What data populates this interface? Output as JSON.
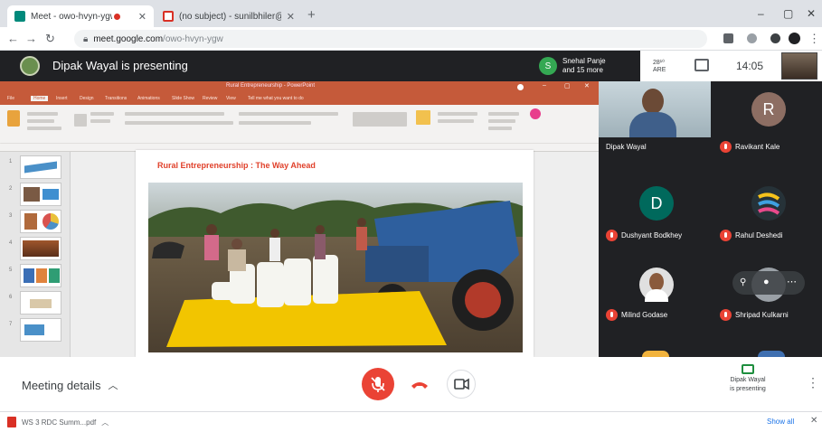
{
  "browser": {
    "tabs": [
      {
        "label": "Meet - owo-hvyn-ygw",
        "active": true
      },
      {
        "label": "(no subject) - sunilbhiler@smtp...",
        "active": false
      }
    ],
    "url_host": "meet.google.com",
    "url_path": "/owo-hvyn-ygw"
  },
  "meet": {
    "presenting_title": "Dipak Wayal is presenting",
    "people_chip": {
      "initial": "S",
      "line1": "Snehal Panje",
      "line2": "and 15 more"
    },
    "people_count_lines": [
      "28¹⁰",
      "ARE"
    ],
    "time": "14:05"
  },
  "ppt": {
    "window_title": "Rural Entrepreneurship - PowerPoint",
    "tabs": [
      "File",
      "Home",
      "Insert",
      "Design",
      "Transitions",
      "Animations",
      "Slide Show",
      "Review",
      "View",
      "Tell me what you want to do"
    ],
    "slide_numbers": [
      "1",
      "2",
      "3",
      "4",
      "5",
      "6",
      "7"
    ],
    "slide_title": "Rural Entrepreneurship : The Way Ahead"
  },
  "participants": [
    {
      "name": "Dipak Wayal",
      "initial": "",
      "color": "",
      "video": true
    },
    {
      "name": "Ravikant Kale",
      "initial": "R",
      "color": "#8d6e63",
      "video": false
    },
    {
      "name": "Dushyant Bodkhey",
      "initial": "D",
      "color": "#00695c",
      "video": false
    },
    {
      "name": "Rahul Deshedi",
      "initial": "",
      "color": "#263238",
      "video": false
    },
    {
      "name": "Milind Godase",
      "initial": "",
      "color": "#e0e0e0",
      "video": false
    },
    {
      "name": "Shripad Kulkarni",
      "initial": "",
      "color": "#5f6368",
      "video": false
    }
  ],
  "controls": {
    "meeting_details": "Meeting details",
    "present_status_line1": "Dipak Wayal",
    "present_status_line2": "is presenting"
  },
  "downloads": {
    "file": "WS 3 RDC Summ...pdf",
    "show_all": "Show all"
  },
  "colors": {
    "accent_red": "#ea4335",
    "meet_dark": "#202124",
    "ppt_orange": "#c55a3a"
  }
}
